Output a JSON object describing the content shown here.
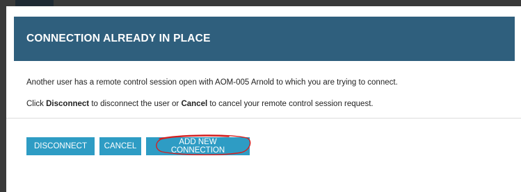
{
  "dialog": {
    "title": "CONNECTION ALREADY IN PLACE",
    "message_line1": "Another user has a remote control session open with AOM-005 Arnold to which you are trying to connect.",
    "message_line2_part1": "Click ",
    "message_line2_disconnect": "Disconnect",
    "message_line2_part2": " to disconnect the user or ",
    "message_line2_cancel": "Cancel",
    "message_line2_part3": " to cancel your remote control session request."
  },
  "buttons": {
    "disconnect_label": "DISCONNECT",
    "cancel_label": "CANCEL",
    "add_new_connection_label": "ADD NEW CONNECTION"
  },
  "colors": {
    "header_bg": "#2f5f7d",
    "button_bg": "#2e9cc4",
    "annotation": "#d42020",
    "backdrop": "#3a3a3a"
  }
}
